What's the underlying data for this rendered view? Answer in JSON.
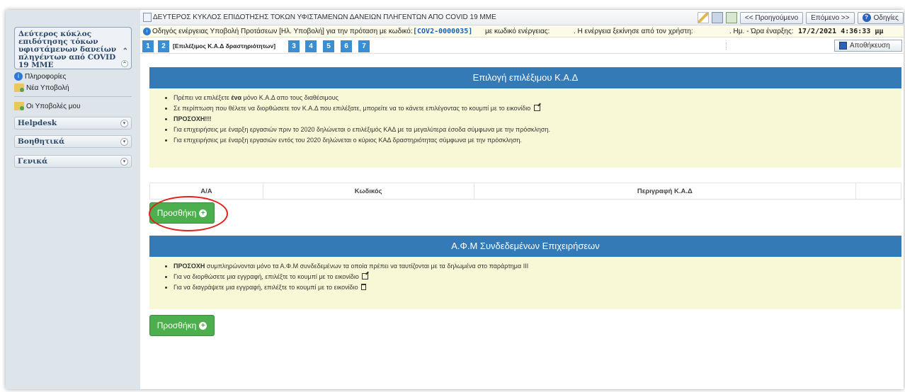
{
  "sidebar": {
    "header_title": "Δεύτερος κύκλος επιδότησης τόκων υφιστάμενων δανείων πληγέντων από COVID 19 ΜΜΕ",
    "links": [
      {
        "label": "Πληροφορίες",
        "icon": "info-icon"
      },
      {
        "label": "Νέα Υποβολή",
        "icon": "folder-icon"
      },
      {
        "label": "Οι Υποβολές μου",
        "icon": "folder-icon"
      }
    ],
    "categories": [
      {
        "label": "Helpdesk"
      },
      {
        "label": "Βοηθητικά"
      },
      {
        "label": "Γενικά"
      }
    ]
  },
  "titlebar": {
    "title": "ΔΕΥΤΕΡΟΣ ΚΥΚΛΟΣ ΕΠΙΔΟΤΗΣΗΣ ΤΟΚΩΝ ΥΦΙΣΤΑΜΕΝΩΝ ΔΑΝΕΙΩΝ ΠΛΗΓΕΝΤΩΝ ΑΠΟ COVID 19 ΜΜΕ",
    "prev_label": "<< Προηγούμενο",
    "next_label": "Επόμενο >>",
    "help_label": "Οδηγίες"
  },
  "infobar": {
    "guide_text": "Οδηγός ενέργειας Υποβολή Προτάσεων [Ηλ. Υποβολή] για την πρόταση με κωδικό:",
    "proposal_code": "[COV2-0000035]",
    "action_code_text": "με κωδικό ενέργειας:",
    "user_text": ". Η ενέργεια ξεκίνησε από τον χρήστη:",
    "date_label": ". Ημ. - Ώρα έναρξης:",
    "date_value": "17/2/2021 4:36:33 μμ"
  },
  "steps": {
    "items": [
      "1",
      "2",
      "3",
      "4",
      "5",
      "6",
      "7"
    ],
    "active_label": "[Επιλέξιμος Κ.Α.Δ δραστηριότητων]",
    "save_label": "Αποθήκευση"
  },
  "kad_section": {
    "title": "Επιλογή επιλέξιμου Κ.Α.Δ",
    "bullet1_pre": "Πρέπει να επιλέξετε ",
    "bullet1_bold": "ένα",
    "bullet1_post": " μόνο Κ.Α.Δ απο τους διαθέσιμους",
    "bullet2": "Σε περίπτωση που θέλετε να διορθώσετε τον Κ.Α.Δ που επιλέξατε, μπορείτε να το κάνετε επιλέγοντας το κουμπί με το εικονίδιο",
    "bullet3": "ΠΡΟΣΟΧΗ!!!",
    "bullet4": "Για επιχειρήσεις με έναρξη εργασιών πριν το 2020 δηλώνεται ο επιλέξιμός ΚΑΔ με τα μεγαλύτερα έσοδα σύμφωνα με την πρόσκληση.",
    "bullet5": "Για επιχειρήσεις με έναρξη εργασιών εντός του 2020 δηλώνεται ο κύριος ΚΑΔ δραστηριότητας σύμφωνα με την πρόσκληση.",
    "table_headers": [
      "Α/Α",
      "Κωδικός",
      "Περιγραφή Κ.Α.Δ",
      ""
    ],
    "add_label": "Προσθήκη"
  },
  "afm_section": {
    "title": "Α.Φ.Μ Συνδεδεμένων Επιχειρήσεων",
    "bullet1_bold": "ΠΡΟΣΟΧΗ",
    "bullet1_post": " συμπληρώνονται μόνο τα Α.Φ.Μ συνδεδεμένων τα οποία πρέπει να ταυτίζονται με τα δηλωμένα στο παράρτημα ΙΙΙ",
    "bullet2": "Για να διορθώσετε μια εγγραφή, επιλέξτε το κουμπί με το εικονίδιο",
    "bullet3": "Για να διαγράψετε μια εγγραφή, επιλέξτε το κουμπί με το εικονίδιο",
    "add_label": "Προσθήκη"
  },
  "colors": {
    "panel_header": "#337ab7",
    "panel_body": "#f9f8d6",
    "add_button": "#4cae4c",
    "step": "#3b8fd0",
    "highlight_ring": "#e0211c"
  }
}
